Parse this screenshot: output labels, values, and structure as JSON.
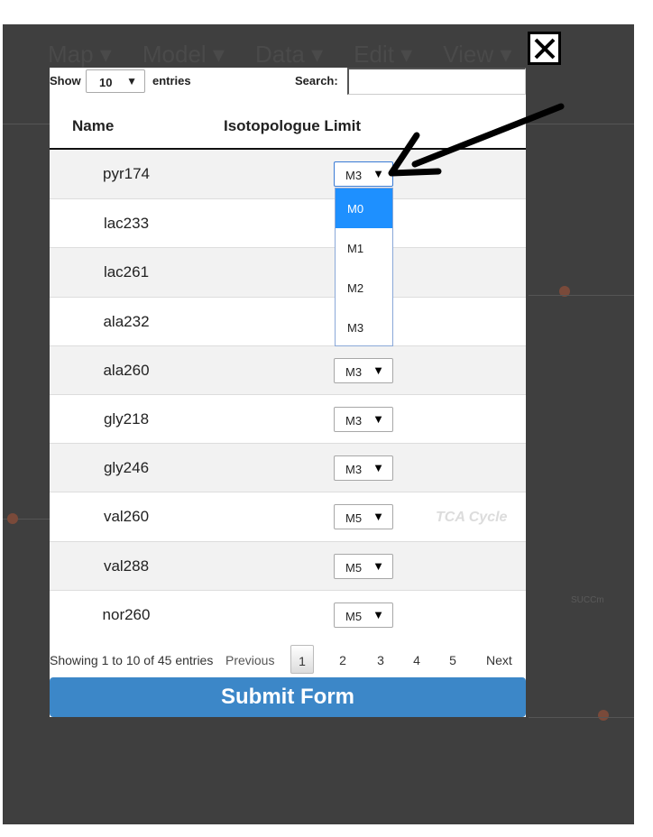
{
  "background": {
    "menus": [
      "Map ▾",
      "Model ▾",
      "Data ▾",
      "Edit ▾",
      "View ▾"
    ],
    "texts": [
      "TCA Cycle",
      "SUCCm"
    ]
  },
  "modal": {
    "length": {
      "show_label": "Show",
      "value": "10",
      "entries_label": "entries"
    },
    "search": {
      "label": "Search:",
      "value": ""
    },
    "columns": {
      "name": "Name",
      "limit": "Isotopologue Limit"
    },
    "rows": [
      {
        "name": "pyr174",
        "limit": "M3"
      },
      {
        "name": "lac233",
        "limit": ""
      },
      {
        "name": "lac261",
        "limit": ""
      },
      {
        "name": "ala232",
        "limit": ""
      },
      {
        "name": "ala260",
        "limit": "M3"
      },
      {
        "name": "gly218",
        "limit": "M3"
      },
      {
        "name": "gly246",
        "limit": "M3"
      },
      {
        "name": "val260",
        "limit": "M5"
      },
      {
        "name": "val288",
        "limit": "M5"
      },
      {
        "name": "nor260",
        "limit": "M5"
      }
    ],
    "dropdown": {
      "options": [
        "M0",
        "M1",
        "M2",
        "M3"
      ],
      "highlighted": "M0"
    },
    "footer": {
      "info": "Showing 1 to 10 of 45 entries",
      "previous": "Previous",
      "pages": [
        "1",
        "2",
        "3",
        "4",
        "5"
      ],
      "current_page": "1",
      "next": "Next"
    },
    "submit_label": "Submit Form"
  },
  "colors": {
    "submit": "#3c87c8",
    "highlight": "#1e90ff",
    "backdrop": "#3f3f3f"
  }
}
